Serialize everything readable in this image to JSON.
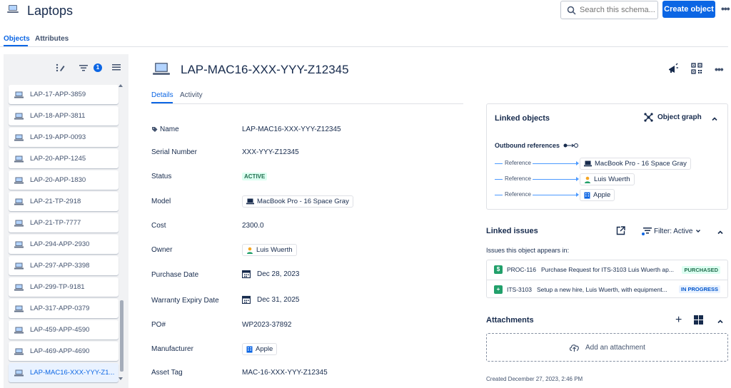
{
  "header": {
    "title": "Laptops",
    "search_placeholder": "Search this schema...",
    "create_label": "Create object",
    "more_label": "•••"
  },
  "tabs": [
    {
      "label": "Objects"
    },
    {
      "label": "Attributes"
    }
  ],
  "sidebar": {
    "filter_count": "1",
    "items": [
      {
        "label": "LAP-17-APP-3859"
      },
      {
        "label": "LAP-18-APP-3811"
      },
      {
        "label": "LAP-19-APP-0093"
      },
      {
        "label": "LAP-20-APP-1245"
      },
      {
        "label": "LAP-20-APP-1830"
      },
      {
        "label": "LAP-21-TP-2918"
      },
      {
        "label": "LAP-21-TP-7777"
      },
      {
        "label": "LAP-294-APP-2930"
      },
      {
        "label": "LAP-297-APP-3398"
      },
      {
        "label": "LAP-299-TP-9181"
      },
      {
        "label": "LAP-317-APP-0379"
      },
      {
        "label": "LAP-459-APP-4590"
      },
      {
        "label": "LAP-469-APP-4690"
      },
      {
        "label": "LAP-MAC16-XXX-YYY-Z1..."
      }
    ],
    "selected_index": 13
  },
  "object": {
    "title": "LAP-MAC16-XXX-YYY-Z12345",
    "tabs": [
      {
        "label": "Details"
      },
      {
        "label": "Activity"
      }
    ],
    "fields": {
      "name": {
        "label": "Name",
        "value": "LAP-MAC16-XXX-YYY-Z12345"
      },
      "serial": {
        "label": "Serial Number",
        "value": "XXX-YYY-Z12345"
      },
      "status": {
        "label": "Status",
        "value": "ACTIVE"
      },
      "model": {
        "label": "Model",
        "value": "MacBook Pro - 16 Space Gray"
      },
      "cost": {
        "label": "Cost",
        "value": "2300.0"
      },
      "owner": {
        "label": "Owner",
        "value": "Luis Wuerth"
      },
      "purchase_date": {
        "label": "Purchase Date",
        "value": "Dec 28, 2023"
      },
      "warranty": {
        "label": "Warranty Expiry Date",
        "value": "Dec 31, 2025"
      },
      "po": {
        "label": "PO#",
        "value": "WP2023-37892"
      },
      "manufacturer": {
        "label": "Manufacturer",
        "value": "Apple"
      },
      "asset_tag": {
        "label": "Asset Tag",
        "value": "MAC-16-XXX-YYY-Z12345"
      }
    }
  },
  "linked_objects": {
    "title": "Linked objects",
    "graph_label": "Object graph",
    "outbound_label": "Outbound references",
    "references": [
      {
        "label": "Reference",
        "target": "MacBook Pro - 16 Space Gray"
      },
      {
        "label": "Reference",
        "target": "Luis Wuerth"
      },
      {
        "label": "Reference",
        "target": "Apple"
      }
    ]
  },
  "linked_issues": {
    "title": "Linked issues",
    "filter_label": "Filter: Active",
    "subtitle": "Issues this object appears in:",
    "issues": [
      {
        "type_glyph": "$",
        "key": "PROC-116",
        "summary": "Purchase Request for ITS-3103 Luis Wuerth ap...",
        "status": "PURCHASED"
      },
      {
        "type_glyph": "+",
        "key": "ITS-3103",
        "summary": "Setup a new hire, Luis Wuerth, with equipment...",
        "status": "IN PROGRESS"
      }
    ]
  },
  "attachments": {
    "title": "Attachments",
    "add_label": "Add an attachment"
  },
  "created": "Created December 27, 2023, 2:46 PM",
  "colors": {
    "accent": "#0c66e4",
    "success": "#216e4e",
    "text": "#172b4d"
  }
}
